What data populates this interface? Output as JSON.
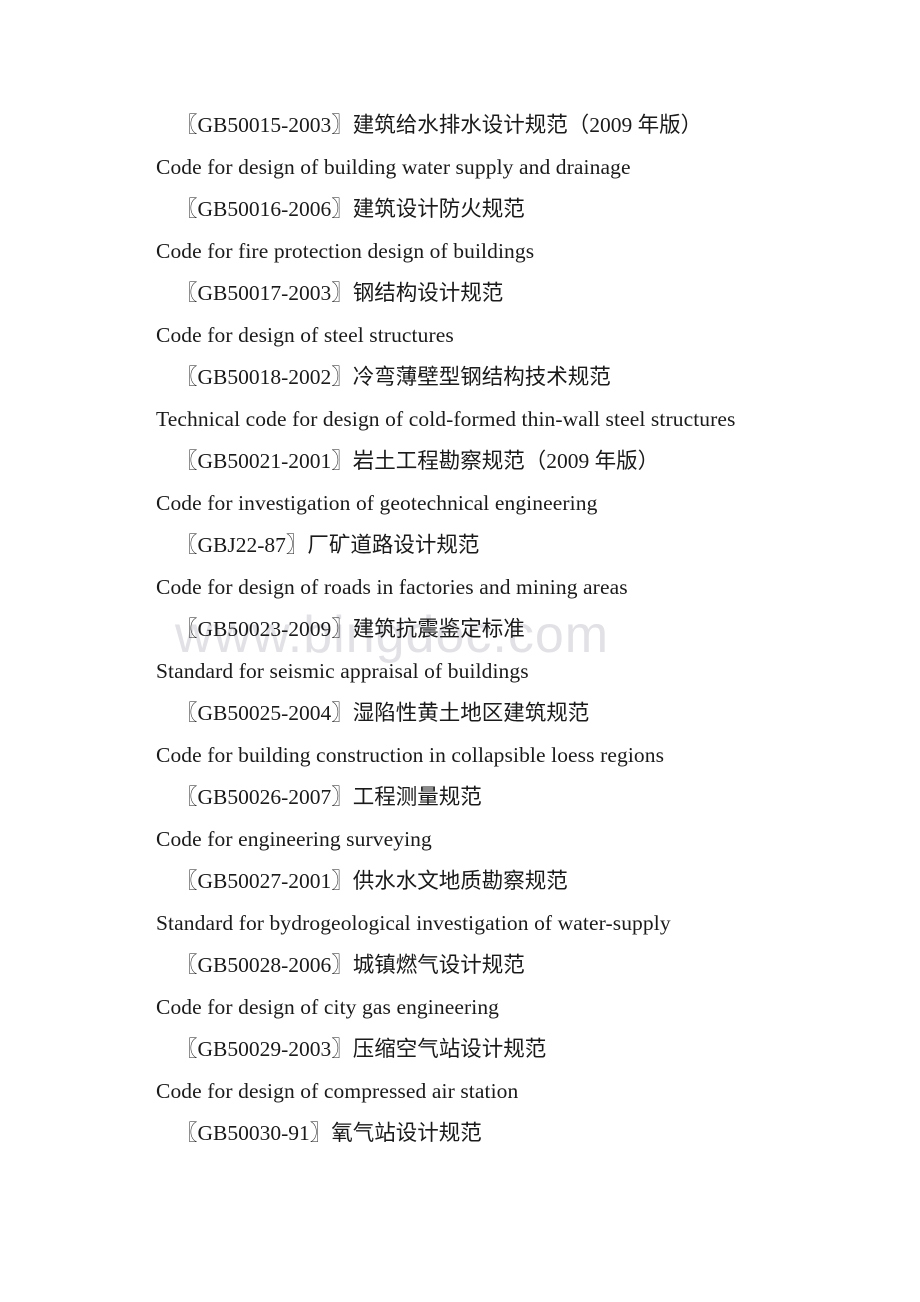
{
  "document": {
    "type": "standards-list",
    "language_mix": "chinese-english",
    "watermark": {
      "text": "www.bingdoc.com",
      "color": "#e2e2e6"
    },
    "text_color": "#1a1a1a",
    "background_color": "#ffffff",
    "lines": [
      {
        "lang": "zh",
        "text": "〖GB50015-2003〗建筑给水排水设计规范（2009 年版）"
      },
      {
        "lang": "en",
        "text": "Code for design of building water supply and drainage"
      },
      {
        "lang": "zh",
        "text": "〖GB50016-2006〗建筑设计防火规范"
      },
      {
        "lang": "en",
        "text": "Code for fire protection design of buildings"
      },
      {
        "lang": "zh",
        "text": "〖GB50017-2003〗钢结构设计规范"
      },
      {
        "lang": "en",
        "text": "Code for design of steel structures"
      },
      {
        "lang": "zh",
        "text": "〖GB50018-2002〗冷弯薄壁型钢结构技术规范"
      },
      {
        "lang": "en",
        "text": "Technical code for design of cold-formed thin-wall steel structures"
      },
      {
        "lang": "zh",
        "text": "〖GB50021-2001〗岩土工程勘察规范（2009 年版）"
      },
      {
        "lang": "en",
        "text": "Code for investigation of geotechnical engineering"
      },
      {
        "lang": "zh",
        "text": "〖GBJ22-87〗厂矿道路设计规范"
      },
      {
        "lang": "en",
        "text": "Code for design of roads in factories and mining areas"
      },
      {
        "lang": "zh",
        "text": "〖GB50023-2009〗建筑抗震鉴定标准"
      },
      {
        "lang": "en",
        "text": "Standard for seismic appraisal of buildings"
      },
      {
        "lang": "zh",
        "text": "〖GB50025-2004〗湿陷性黄土地区建筑规范"
      },
      {
        "lang": "en",
        "text": "Code for building construction in collapsible loess regions"
      },
      {
        "lang": "zh",
        "text": "〖GB50026-2007〗工程测量规范"
      },
      {
        "lang": "en",
        "text": "Code for engineering surveying"
      },
      {
        "lang": "zh",
        "text": "〖GB50027-2001〗供水水文地质勘察规范"
      },
      {
        "lang": "en",
        "text": "Standard for bydrogeological investigation of water-supply"
      },
      {
        "lang": "zh",
        "text": "〖GB50028-2006〗城镇燃气设计规范"
      },
      {
        "lang": "en",
        "text": "Code for design of city gas engineering"
      },
      {
        "lang": "zh",
        "text": "〖GB50029-2003〗压缩空气站设计规范"
      },
      {
        "lang": "en",
        "text": "Code for design of compressed air station"
      },
      {
        "lang": "zh",
        "text": "〖GB50030-91〗氧气站设计规范"
      }
    ]
  }
}
